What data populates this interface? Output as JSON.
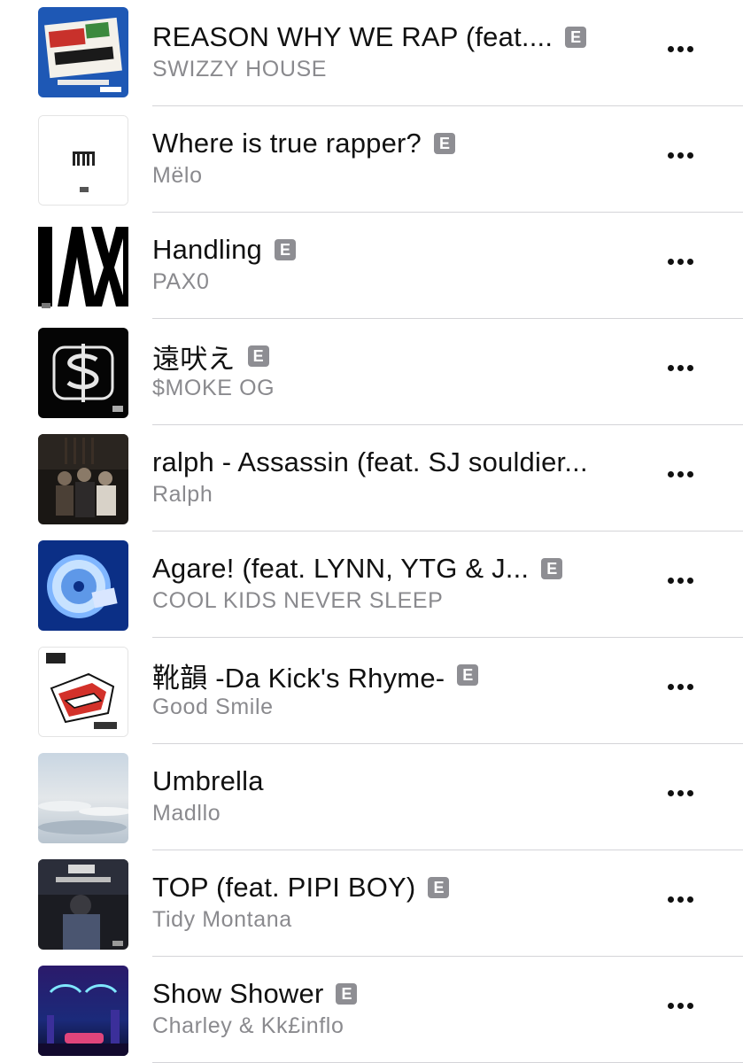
{
  "tracks": [
    {
      "title": "REASON WHY WE RAP (feat....",
      "artist": "SWIZZY HOUSE",
      "explicit": true,
      "explicit_label": "E",
      "artwork": "swizzy-pack-cover"
    },
    {
      "title": "Where is true rapper?",
      "artist": "Mëlo",
      "explicit": true,
      "explicit_label": "E",
      "artwork": "white-minimal-cover"
    },
    {
      "title": "Handling",
      "artist": "PAX0",
      "explicit": true,
      "explicit_label": "E",
      "artwork": "pax0-bold-letters-cover"
    },
    {
      "title": "遠吠え",
      "artist": "$MOKE OG",
      "explicit": true,
      "explicit_label": "E",
      "artwork": "dollar-sign-black-cover"
    },
    {
      "title": "ralph - Assassin (feat. SJ souldier...",
      "artist": "Ralph",
      "explicit": false,
      "explicit_label": "",
      "artwork": "group-photo-dark-cover"
    },
    {
      "title": "Agare! (feat. LYNN, YTG & J...",
      "artist": "COOL KIDS NEVER SLEEP",
      "explicit": true,
      "explicit_label": "E",
      "artwork": "blue-cd-cover"
    },
    {
      "title": "靴韻 -Da Kick's Rhyme-",
      "artist": "Good Smile",
      "explicit": true,
      "explicit_label": "E",
      "artwork": "sneaker-illustration-cover"
    },
    {
      "title": "Umbrella",
      "artist": "Madllo",
      "explicit": false,
      "explicit_label": "",
      "artwork": "cloudy-sky-cover"
    },
    {
      "title": "TOP (feat. PIPI BOY)",
      "artist": "Tidy Montana",
      "explicit": true,
      "explicit_label": "E",
      "artwork": "night-portrait-cover"
    },
    {
      "title": "Show Shower",
      "artist": "Charley & Kk£inflo",
      "explicit": true,
      "explicit_label": "E",
      "artwork": "neon-city-cover"
    }
  ],
  "more_icon": "ellipsis-icon"
}
